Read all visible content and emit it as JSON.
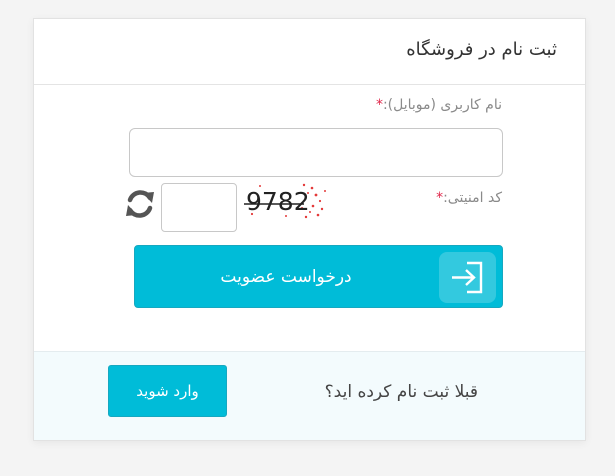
{
  "form": {
    "title": "ثبت نام در فروشگاه",
    "username_label": "نام کاربری (موبایل):",
    "username_value": "",
    "captcha_label": "کد امنیتی:",
    "required_mark": "*",
    "captcha_code": "9782",
    "captcha_input_value": "",
    "submit_label": "درخواست عضویت"
  },
  "footer": {
    "question": "قبلا ثبت نام کرده اید؟",
    "login_label": "وارد شوید"
  },
  "colors": {
    "accent": "#00bcd8",
    "required": "#e0264a",
    "footer_bg": "#f3fbfd"
  },
  "icons": {
    "refresh": "refresh-icon",
    "submit": "sign-in-icon"
  }
}
